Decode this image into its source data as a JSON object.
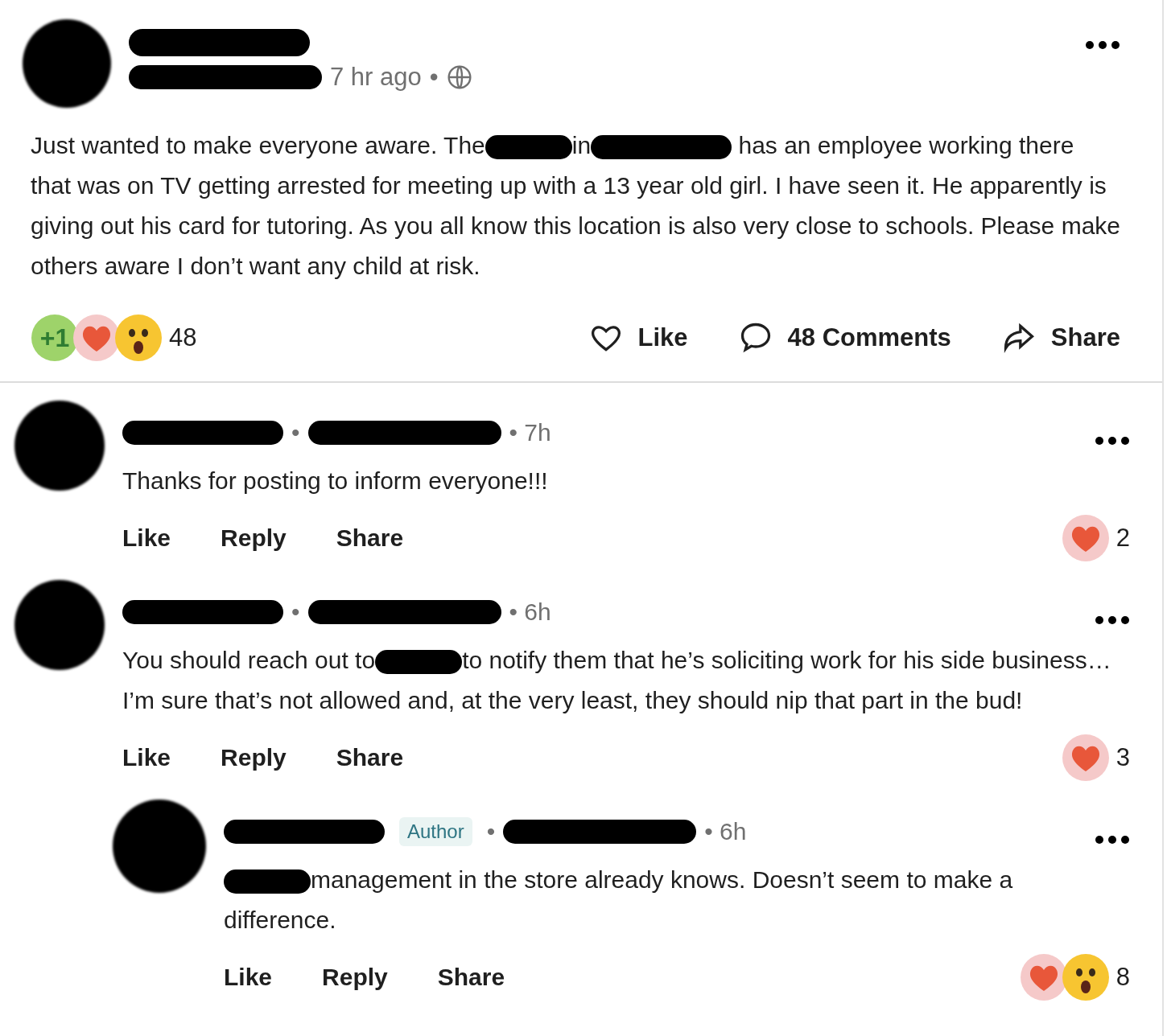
{
  "post": {
    "header": [
      {
        "kind": "redaction"
      },
      {
        "kind": "text",
        "text": "7 hr ago"
      },
      {
        "kind": "text",
        "text": "•"
      },
      {
        "kind": "globe"
      }
    ],
    "body": [
      {
        "kind": "text",
        "text": "Just wanted to make everyone aware. The"
      },
      {
        "kind": "redaction"
      },
      {
        "kind": "text",
        "text": "in"
      },
      {
        "kind": "redaction"
      },
      {
        "kind": "text",
        "text": " has an employee working there that was on TV getting arrested for meeting up with a 13 year old girl. I have seen it. He apparently is giving out his card for tutoring. As you all know this location is also very close to schools. Please make others aware I don’t want any child at risk."
      }
    ],
    "reactions": [
      {
        "kind": "plus_one",
        "label": "+1"
      },
      {
        "kind": "love"
      },
      {
        "kind": "wow"
      }
    ],
    "reaction_count": "48",
    "actions": [
      {
        "kind": "like",
        "label": "Like"
      },
      {
        "kind": "comment",
        "label": "48 Comments"
      },
      {
        "kind": "share",
        "label": "Share"
      }
    ]
  },
  "comments": [
    {
      "header": [
        {
          "kind": "redaction"
        },
        {
          "kind": "text",
          "text": "•"
        },
        {
          "kind": "redaction"
        },
        {
          "kind": "text",
          "text": "• 7h"
        }
      ],
      "body": [
        {
          "kind": "text",
          "text": "Thanks for posting to inform everyone!!!"
        }
      ],
      "actions": [
        "Like",
        "Reply",
        "Share"
      ],
      "reactions": [
        {
          "kind": "love"
        }
      ],
      "reaction_count": "2"
    },
    {
      "header": [
        {
          "kind": "redaction"
        },
        {
          "kind": "text",
          "text": "•"
        },
        {
          "kind": "redaction"
        },
        {
          "kind": "text",
          "text": "• 6h"
        }
      ],
      "body": [
        {
          "kind": "text",
          "text": "You should reach out to"
        },
        {
          "kind": "redaction"
        },
        {
          "kind": "text",
          "text": "to notify them that he’s soliciting work for his side business… I’m sure that’s not allowed and, at the very least, they should nip that part in the bud!"
        }
      ],
      "actions": [
        "Like",
        "Reply",
        "Share"
      ],
      "reactions": [
        {
          "kind": "love"
        }
      ],
      "reaction_count": "3",
      "children": [
        {
          "header": [
            {
              "kind": "redaction"
            },
            {
              "kind": "badge",
              "text": "Author"
            },
            {
              "kind": "text",
              "text": "•"
            },
            {
              "kind": "redaction"
            },
            {
              "kind": "text",
              "text": "• 6h"
            }
          ],
          "body": [
            {
              "kind": "redaction"
            },
            {
              "kind": "text",
              "text": "management in the store already knows. Doesn’t seem to make a difference."
            }
          ],
          "actions": [
            "Like",
            "Reply",
            "Share"
          ],
          "reactions": [
            {
              "kind": "love"
            },
            {
              "kind": "wow"
            }
          ],
          "reaction_count": "8"
        }
      ]
    }
  ]
}
